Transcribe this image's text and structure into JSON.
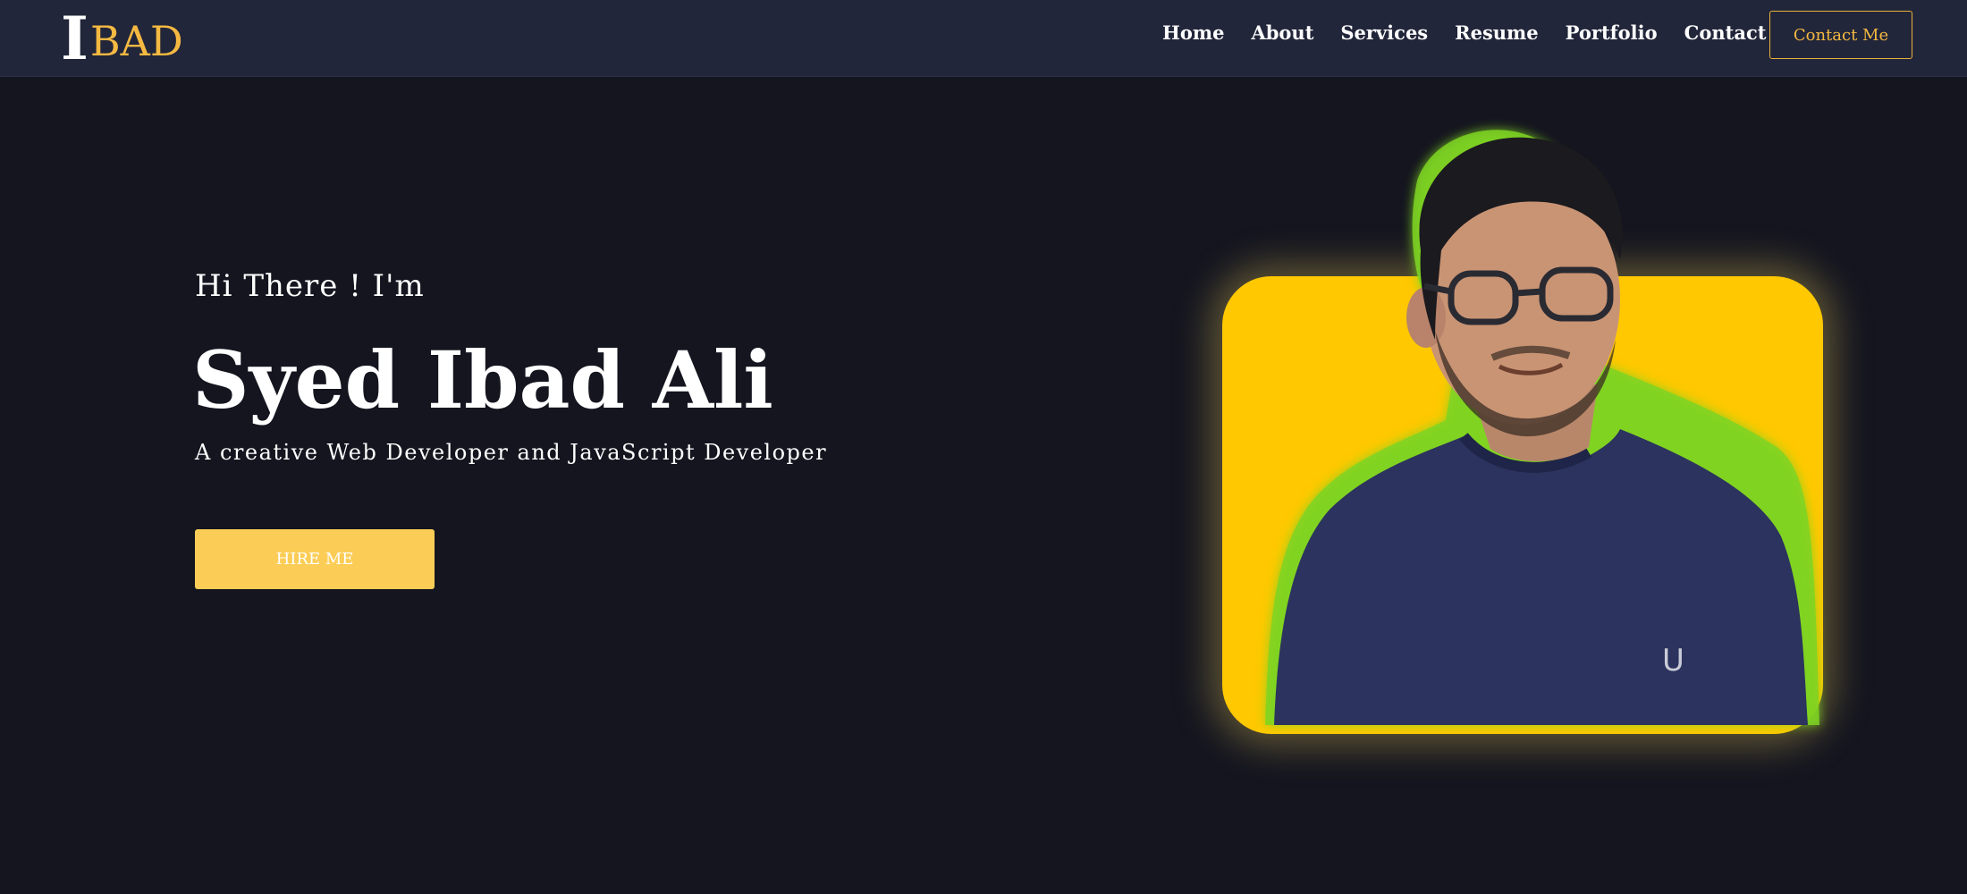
{
  "logo": {
    "initial": "I",
    "rest": "BAD"
  },
  "nav": {
    "items": [
      {
        "label": "Home"
      },
      {
        "label": "About"
      },
      {
        "label": "Services"
      },
      {
        "label": "Resume"
      },
      {
        "label": "Portfolio"
      },
      {
        "label": "Contact"
      }
    ],
    "cta_label": "Contact Me"
  },
  "hero": {
    "intro": "Hi There ! I'm",
    "name": "Syed Ibad Ali",
    "tagline": "A creative Web Developer and JavaScript Developer",
    "button_label": "HIRE ME"
  },
  "colors": {
    "background": "#14151f",
    "navbar": "#22263a",
    "accent": "#f5b942",
    "button": "#fccd56",
    "portrait_card": "#ffc800",
    "portrait_glow": "#7ed321"
  },
  "icons": {
    "portrait": "profile-photo"
  }
}
